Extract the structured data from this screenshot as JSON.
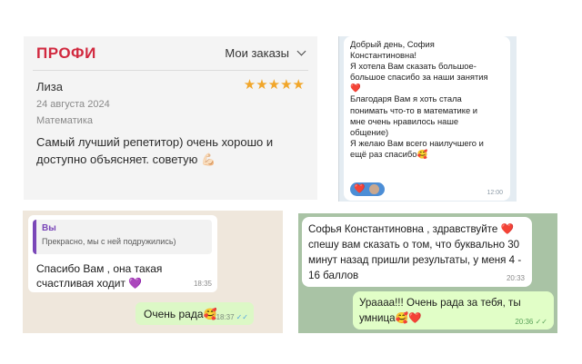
{
  "profi": {
    "logo": "ПРОФИ",
    "orders_label": "Мои заказы",
    "reviewer": "Лиза",
    "date": "24 августа 2024",
    "subject": "Математика",
    "rating": 5,
    "review_line1": "Самый лучший репетитор) очень хорошо и",
    "review_line2": "доступно объясняет. советую 💪🏻"
  },
  "chat2": {
    "text": "Добрый день, София\nКонстантиновна!\nЯ хотела Вам сказать большое-\nбольшое спасибо за наши занятия\n❤️\nБлагодаря Вам я хоть стала\nпонимать что-то в математике и\nмне очень нравилось наше\nобщение)\nЯ желаю Вам всего наилучшего и\nещё раз спасибо🥰",
    "reaction": "❤️",
    "time": "12:00"
  },
  "whatsapp": {
    "quote_name": "Вы",
    "quote_text": "Прекрасно, мы с ней подружились)",
    "in_text": "Спасибо Вам , она такая счастливая ходит 💜",
    "in_time": "18:35",
    "out_text": "Очень рада🥰",
    "out_time": "18:37",
    "ticks": "✓✓"
  },
  "telegram": {
    "in_text": "Софья Константиновна , здравствуйте ❤️ спешу вам сказать о том, что буквально 30 минут назад пришли результаты, у меня 4 - 16 баллов",
    "in_time": "20:33",
    "out_text": "Ураааа!!! Очень рада за тебя, ты умница🥰❤️",
    "out_time": "20:36 ✓✓"
  }
}
